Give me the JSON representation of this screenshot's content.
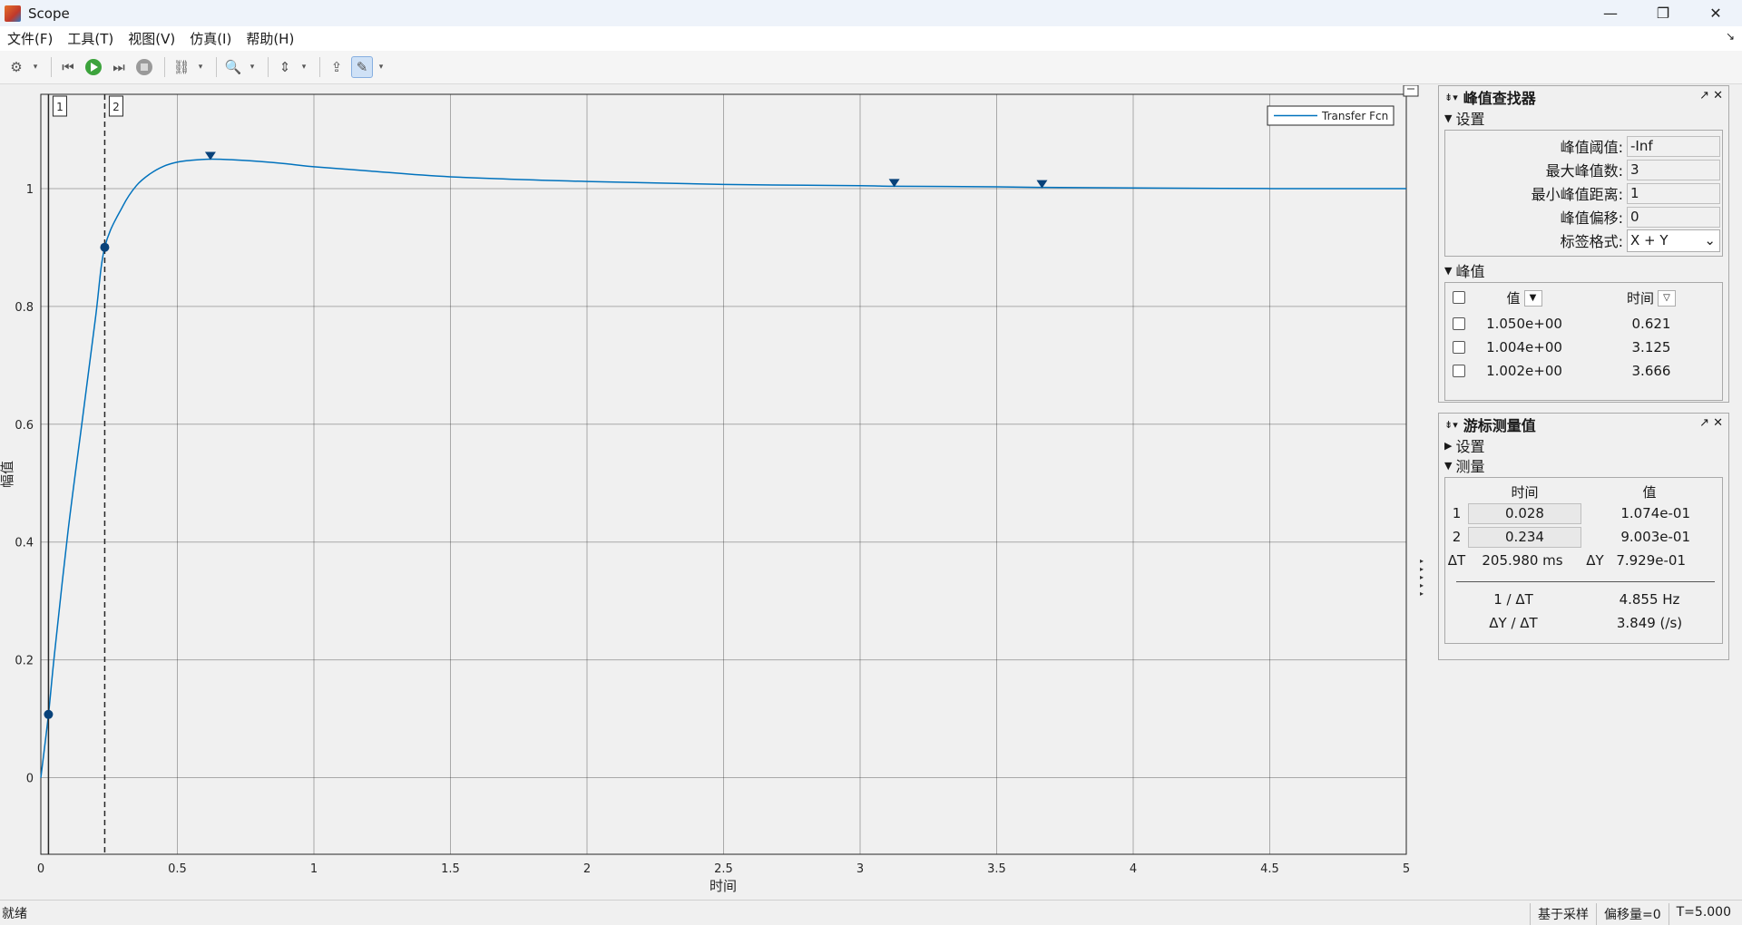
{
  "window": {
    "title": "Scope",
    "minimize": "—",
    "restore": "❐",
    "close": "✕"
  },
  "menu": [
    "文件(F)",
    "工具(T)",
    "视图(V)",
    "仿真(I)",
    "帮助(H)"
  ],
  "menu_end_icon": "↘",
  "toolbar_icons": [
    "gear-icon",
    "rewind-icon",
    "run-icon",
    "step-forward-icon",
    "stop-icon",
    "signal-icon",
    "zoom-icon",
    "fit-icon",
    "highlight-icon",
    "cursor-measure-icon"
  ],
  "chart_data": {
    "type": "line",
    "title": "",
    "xlabel": "时间",
    "ylabel": "幅值",
    "xlim": [
      0,
      5
    ],
    "ylim": [
      -0.13,
      1.16
    ],
    "xticks": [
      "0",
      "0.5",
      "1",
      "1.5",
      "2",
      "2.5",
      "3",
      "3.5",
      "4",
      "4.5",
      "5"
    ],
    "yticks": [
      "0",
      "0.2",
      "0.4",
      "0.6",
      "0.8",
      "1"
    ],
    "grid": true,
    "legend": "top-right",
    "series": [
      {
        "name": "Transfer Fcn",
        "color": "#0072bd",
        "x": [
          0,
          0.028,
          0.05,
          0.1,
          0.15,
          0.2,
          0.234,
          0.3,
          0.35,
          0.4,
          0.45,
          0.5,
          0.55,
          0.621,
          0.7,
          0.8,
          0.9,
          1.0,
          1.2,
          1.5,
          2.0,
          2.5,
          3.0,
          3.125,
          3.5,
          3.666,
          4.0,
          4.5,
          5.0
        ],
        "y": [
          0,
          0.1074,
          0.21,
          0.42,
          0.6,
          0.78,
          0.9003,
          0.97,
          1.005,
          1.025,
          1.038,
          1.045,
          1.048,
          1.05,
          1.049,
          1.046,
          1.042,
          1.037,
          1.03,
          1.02,
          1.012,
          1.007,
          1.005,
          1.004,
          1.003,
          1.002,
          1.001,
          1.0,
          1.0
        ]
      }
    ],
    "peaks_marked": [
      {
        "x": 0.621,
        "y": 1.05
      },
      {
        "x": 3.125,
        "y": 1.004
      },
      {
        "x": 3.666,
        "y": 1.002
      }
    ],
    "cursors": [
      {
        "label": "1",
        "x": 0.028,
        "y": 0.1074,
        "style": "solid"
      },
      {
        "label": "2",
        "x": 0.234,
        "y": 0.9003,
        "style": "dashed"
      }
    ]
  },
  "peak_finder": {
    "title": "峰值查找器",
    "settings_label": "设置",
    "fields": [
      {
        "label": "峰值阈值:",
        "value": "-Inf"
      },
      {
        "label": "最大峰值数:",
        "value": "3"
      },
      {
        "label": "最小峰值距离:",
        "value": "1"
      },
      {
        "label": "峰值偏移:",
        "value": "0"
      }
    ],
    "label_format_label": "标签格式:",
    "label_format_value": "X + Y",
    "peaks_label": "峰值",
    "col_value": "值",
    "col_time": "时间",
    "rows": [
      {
        "value": "1.050e+00",
        "time": "0.621"
      },
      {
        "value": "1.004e+00",
        "time": "3.125"
      },
      {
        "value": "1.002e+00",
        "time": "3.666"
      }
    ]
  },
  "cursor_measure": {
    "title": "游标测量值",
    "settings_label": "设置",
    "measure_label": "测量",
    "col_time": "时间",
    "col_value": "值",
    "rows": [
      {
        "idx": "1",
        "time": "0.028",
        "value": "1.074e-01"
      },
      {
        "idx": "2",
        "time": "0.234",
        "value": "9.003e-01"
      }
    ],
    "dt_label": "ΔT",
    "dt_value": "205.980 ms",
    "dy_label": "ΔY",
    "dy_value": "7.929e-01",
    "inv_dt_label": "1 / ΔT",
    "inv_dt_value": "4.855 Hz",
    "dydt_label": "ΔY / ΔT",
    "dydt_value": "3.849 (/s)"
  },
  "status": {
    "left": "就绪",
    "sample_based": "基于采样",
    "offset": "偏移量=0",
    "time": "T=5.000"
  }
}
